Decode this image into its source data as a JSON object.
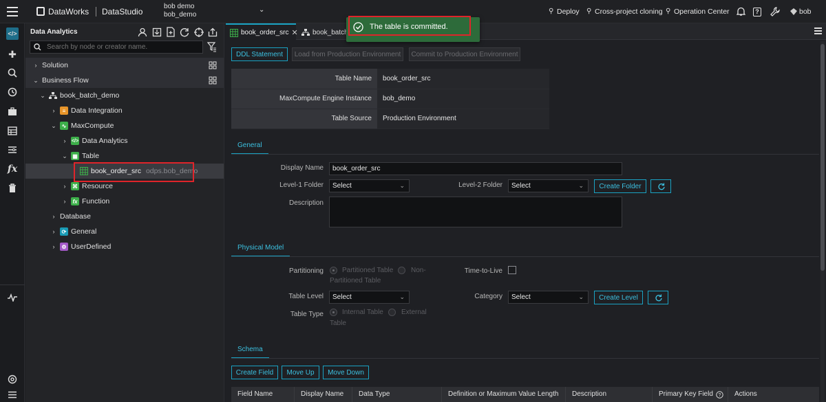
{
  "header": {
    "brand": "DataWorks",
    "module": "DataStudio",
    "workspace_line1": "bob demo",
    "workspace_line2": "bob_demo",
    "deploy": "Deploy",
    "cross_project": "Cross-project cloning",
    "operation_center": "Operation Center",
    "user": "bob"
  },
  "tree": {
    "title": "Data Analytics",
    "search_placeholder": "Search by node or creator name.",
    "solution": "Solution",
    "business_flow": "Business Flow",
    "flow_name": "book_batch_demo",
    "data_integration": "Data Integration",
    "maxcompute": "MaxCompute",
    "data_analytics": "Data Analytics",
    "table": "Table",
    "table_node": "book_order_src",
    "table_node_sub": "odps.bob_demo",
    "resource": "Resource",
    "function": "Function",
    "database": "Database",
    "general": "General",
    "user_defined": "UserDefined"
  },
  "tabs": {
    "tab1": "book_order_src",
    "tab2": "book_batch"
  },
  "toast": {
    "message": "The table is committed."
  },
  "toolbar": {
    "ddl": "DDL Statement",
    "load_prod": "Load from Production Environment",
    "commit_prod": "Commit to Production Environment"
  },
  "info": {
    "rows": [
      {
        "k": "Table Name",
        "v": "book_order_src"
      },
      {
        "k": "MaxCompute Engine Instance",
        "v": "bob_demo"
      },
      {
        "k": "Table Source",
        "v": "Production Environment"
      }
    ]
  },
  "general": {
    "section": "General",
    "display_name_label": "Display Name",
    "display_name_value": "book_order_src",
    "level1_label": "Level-1 Folder",
    "level1_value": "Select",
    "level2_label": "Level-2 Folder",
    "level2_value": "Select",
    "create_folder": "Create Folder",
    "description_label": "Description"
  },
  "physical": {
    "section": "Physical Model",
    "partitioning_label": "Partitioning",
    "partitioned": "Partitioned Table",
    "non_partitioned_1": "Non-",
    "non_partitioned_2": "Partitioned Table",
    "ttl_label": "Time-to-Live",
    "table_level_label": "Table Level",
    "table_level_value": "Select",
    "category_label": "Category",
    "category_value": "Select",
    "create_level": "Create Level",
    "table_type_label": "Table Type",
    "internal_1": "Internal Table",
    "external_1": "External",
    "internal_2": "Table"
  },
  "schema": {
    "section": "Schema",
    "create_field": "Create Field",
    "move_up": "Move Up",
    "move_down": "Move Down",
    "columns": [
      "Field Name",
      "Display Name",
      "Data Type",
      "Definition or Maximum Value Length",
      "Description",
      "Primary Key Field",
      "Actions"
    ]
  },
  "colors": {
    "accent": "#1aa3c4",
    "toast_bg": "#2d6b3a",
    "highlight_border": "#e0242a"
  }
}
